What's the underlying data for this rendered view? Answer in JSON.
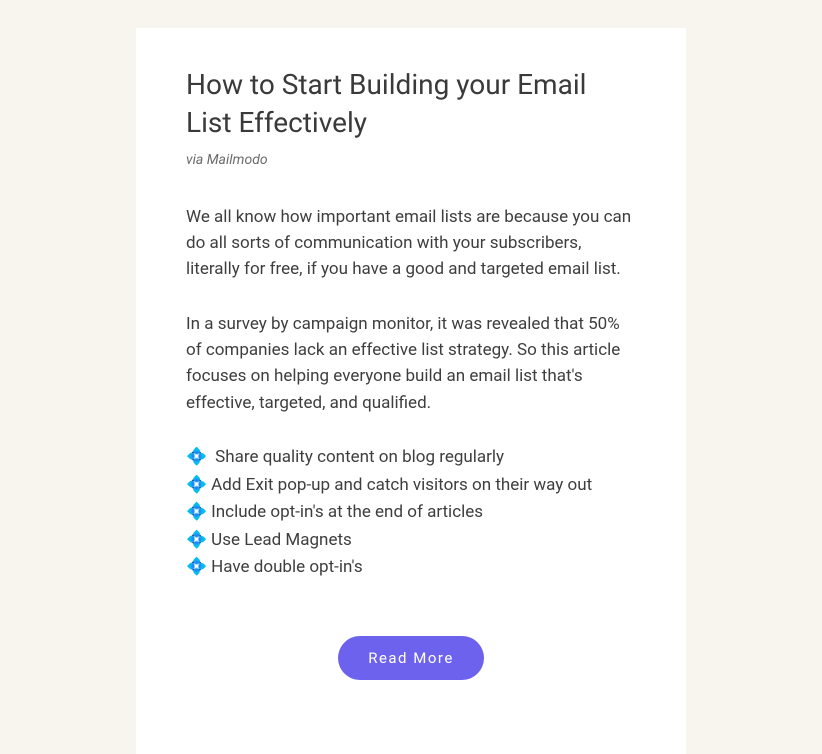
{
  "article": {
    "title": "How to Start Building your Email List Effectively",
    "byline": "via Mailmodo",
    "paragraph1": "We all know how important email lists are because you can do all sorts of communication with your subscribers, literally for free, if you have a good and targeted email list.",
    "paragraph2": "In a survey by campaign monitor, it was revealed that 50% of companies lack an effective list strategy. So this article focuses on helping everyone build an email list that's effective, targeted, and qualified.",
    "tips": [
      "Share quality content on blog regularly",
      "Add Exit pop-up and catch visitors on their way out",
      "Include opt-in's at the end of articles",
      "Use Lead Magnets",
      "Have double opt-in's"
    ],
    "tip_icon": "💠",
    "cta_label": "Read More"
  }
}
